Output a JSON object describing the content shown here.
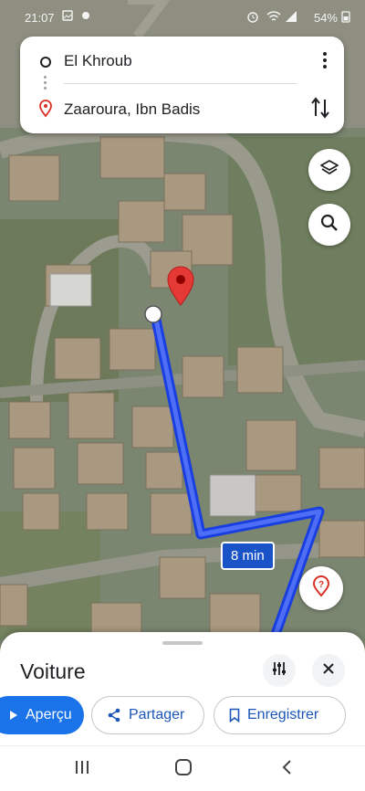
{
  "status_bar": {
    "time": "21:07",
    "battery": "54%"
  },
  "directions": {
    "origin": "El Khroub",
    "destination": "Zaaroura, Ibn Badis",
    "menu_icon": "more-vert-icon",
    "swap_icon": "swap-vertical-icon"
  },
  "map": {
    "eta_label": "8 min",
    "layers_icon": "layers-icon",
    "search_icon": "search-icon",
    "report_icon": "report-issue-icon",
    "route_color": "#1a3fe0",
    "pin_color": "#e53935"
  },
  "sheet": {
    "mode": "Voiture",
    "options_icon": "tune-icon",
    "close_icon": "close-icon",
    "buttons": {
      "preview": "Aperçu",
      "share": "Partager",
      "save": "Enregistrer"
    }
  },
  "colors": {
    "accent": "#1a73e8",
    "card": "#ffffff"
  }
}
